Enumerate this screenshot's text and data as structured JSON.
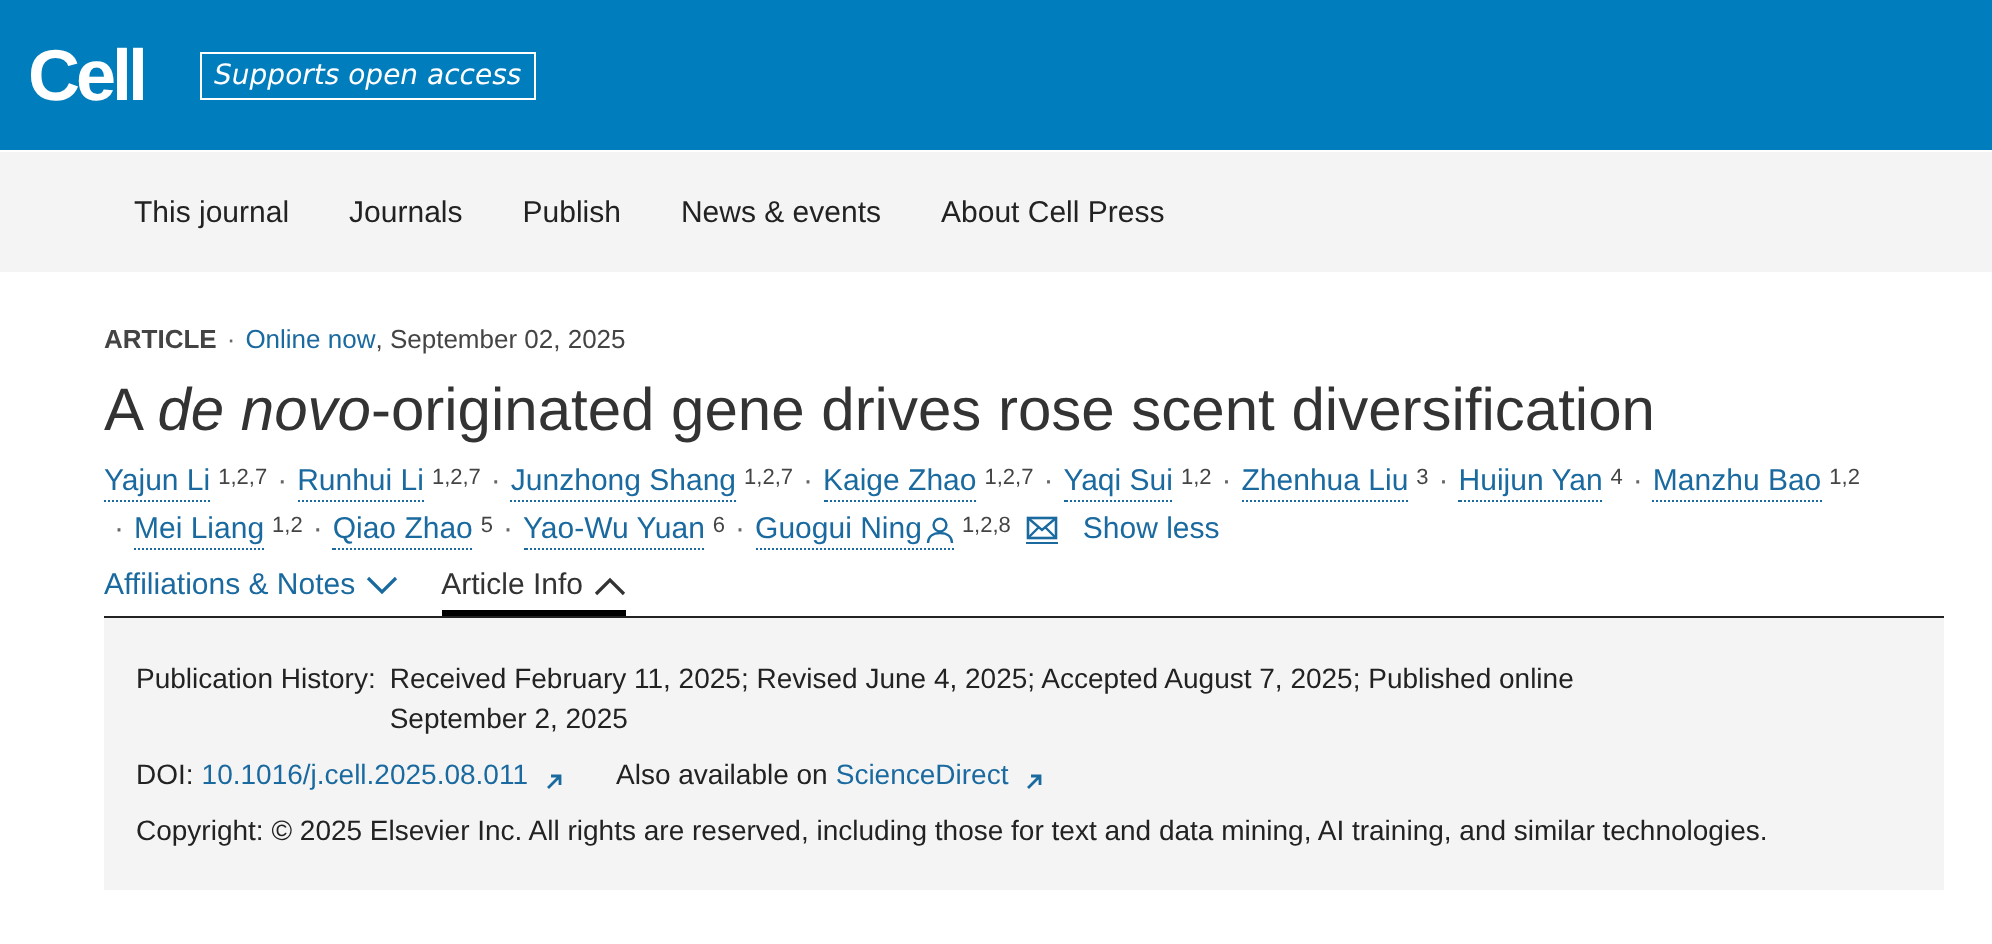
{
  "header": {
    "logo": "Cell",
    "badge": "Supports open access"
  },
  "nav": [
    "This journal",
    "Journals",
    "Publish",
    "News & events",
    "About Cell Press"
  ],
  "article": {
    "type": "ARTICLE",
    "dot": "·",
    "status": "Online now",
    "date": ", September 02, 2025",
    "title": "A *de novo*-originated gene drives rose scent diversification"
  },
  "author_rows": [
    [
      {
        "name": "Yajun Li",
        "sup": "1,2,7",
        "corresponding": false
      },
      {
        "sep": "·",
        "name": "Runhui Li",
        "sup": "1,2,7",
        "corresponding": false
      },
      {
        "sep": "·",
        "name": "Junzhong Shang",
        "sup": "1,2,7",
        "corresponding": false
      },
      {
        "sep": "·",
        "name": "Kaige Zhao",
        "sup": "1,2,7",
        "corresponding": false
      },
      {
        "sep": "·",
        "name": "Yaqi Sui",
        "sup": "1,2",
        "corresponding": false
      },
      {
        "sep": "·",
        "name": "Zhenhua Liu",
        "sup": "3",
        "corresponding": false
      },
      {
        "sep": "·",
        "name": "Huijun Yan",
        "sup": "4",
        "corresponding": false
      },
      {
        "sep": "·",
        "name": "Manzhu Bao",
        "sup": "1,2",
        "corresponding": false
      }
    ],
    [
      {
        "sep": "·",
        "name": "Mei Liang",
        "sup": "1,2",
        "corresponding": false
      },
      {
        "sep": "·",
        "name": "Qiao Zhao",
        "sup": "5",
        "corresponding": false
      },
      {
        "sep": "·",
        "name": "Yao-Wu Yuan",
        "sup": "6",
        "corresponding": false
      },
      {
        "sep": "·",
        "name": "Guogui Ning",
        "sup": "1,2,8",
        "corresponding": true
      }
    ]
  ],
  "show_less": "Show less",
  "tabs": [
    {
      "label": "Affiliations & Notes",
      "selected": false
    },
    {
      "label": "Article Info",
      "selected": true
    }
  ],
  "info": {
    "history_label": "Publication History:",
    "history": "Received February 11, 2025; Revised June 4, 2025; Accepted August 7, 2025; Published online September 2, 2025",
    "doi_label": "DOI:",
    "doi": "10.1016/j.cell.2025.08.011",
    "also": "Also available on",
    "also_link": "ScienceDirect",
    "copyright": "Copyright: © 2025 Elsevier Inc. All rights are reserved, including those for text and data mining, AI training, and similar technologies."
  }
}
